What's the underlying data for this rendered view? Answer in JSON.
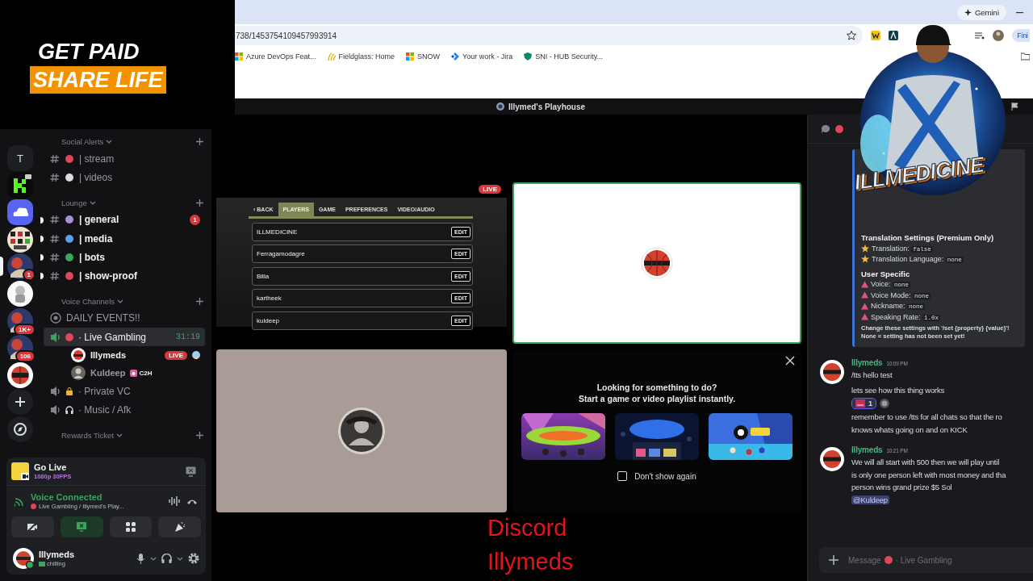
{
  "overlay": {
    "slogan": [
      "GET PAID",
      "SHARE LIFE"
    ],
    "mascot_title": "ILLMEDICINE",
    "caption": [
      "Discord",
      "Illymeds"
    ]
  },
  "browser": {
    "assistant_button": "Gemini",
    "url": "738/1453754109457993914",
    "profile_button": "Fini",
    "bookmarks": [
      {
        "label": "Azure DevOps Feat...",
        "kind": "squares"
      },
      {
        "label": "Fieldglass: Home",
        "kind": "leaf"
      },
      {
        "label": "SNOW",
        "kind": "squares"
      },
      {
        "label": "Your work - Jira",
        "kind": "jira"
      },
      {
        "label": "SNI - HUB Security...",
        "kind": "shield"
      }
    ]
  },
  "window": {
    "title": "Illymed's Playhouse"
  },
  "servers": [
    {
      "kind": "letter",
      "label": "T",
      "selected": false
    },
    {
      "kind": "kick",
      "selected": false
    },
    {
      "kind": "cloud",
      "selected": false
    },
    {
      "kind": "grid",
      "selected": false
    },
    {
      "kind": "art",
      "badge": "1",
      "selected": true
    },
    {
      "kind": "astronaut",
      "selected": false
    },
    {
      "kind": "art",
      "badge": "1K+",
      "selected": false
    },
    {
      "kind": "art",
      "badge": "106",
      "selected": false
    },
    {
      "kind": "ball",
      "selected": false
    },
    {
      "kind": "add"
    },
    {
      "kind": "discover"
    }
  ],
  "sidebar": {
    "channels": [
      {
        "kind": "category",
        "name": "Social Alerts"
      },
      {
        "kind": "text",
        "name": "| stream",
        "unread": false
      },
      {
        "kind": "text",
        "name": "| videos",
        "unread": false
      },
      {
        "kind": "category",
        "name": "Lounge"
      },
      {
        "kind": "text",
        "name": "| general",
        "unread": true,
        "badge": "1"
      },
      {
        "kind": "text",
        "name": "| media",
        "unread": true
      },
      {
        "kind": "text",
        "name": "| bots",
        "unread": true
      },
      {
        "kind": "text",
        "name": "| show-proof",
        "unread": true
      },
      {
        "kind": "category",
        "name": "Voice Channels"
      },
      {
        "kind": "stage",
        "name": "DAILY EVENTS!!"
      },
      {
        "kind": "voice",
        "name": "· Live Gambling",
        "selected": true,
        "timer": "31:19",
        "members": [
          {
            "name": "Illymeds",
            "badge": "LIVE"
          },
          {
            "name": "Kuldeep",
            "tag": "C2H"
          }
        ]
      },
      {
        "kind": "voice",
        "name": "· Private VC",
        "selected": false
      },
      {
        "kind": "voice",
        "name": "· Music / Afk",
        "selected": false
      },
      {
        "kind": "category",
        "name": "Rewards Ticket"
      }
    ]
  },
  "user_panel": {
    "go_live": {
      "title": "Go Live",
      "quality": "1080p 30FPS"
    },
    "voice": {
      "status": "Voice Connected",
      "channel": "Live Gambling / Illymed's Play..."
    },
    "user": {
      "name": "Illymeds",
      "status": "chilling"
    }
  },
  "stage": {
    "tiles": [
      {
        "kind": "screen",
        "badge": "LIVE",
        "speaking": false,
        "app": {
          "tabs": [
            {
              "label": "‹ BACK",
              "selected": false
            },
            {
              "label": "PLAYERS",
              "selected": true
            },
            {
              "label": "GAME",
              "selected": false
            },
            {
              "label": "PREFERENCES",
              "selected": false
            },
            {
              "label": "VIDEO/AUDIO",
              "selected": false
            }
          ],
          "players": [
            {
              "name": "ILLMEDICINE",
              "button": "EDIT"
            },
            {
              "name": "Ferragamodagre",
              "button": "EDIT"
            },
            {
              "name": "Billa",
              "button": "EDIT"
            },
            {
              "name": "kartheek",
              "button": "EDIT"
            },
            {
              "name": "kuldeep",
              "button": "EDIT"
            }
          ]
        }
      },
      {
        "kind": "avatar",
        "speaking": true
      },
      {
        "kind": "avatar",
        "speaking": false
      }
    ],
    "activity": {
      "heading": "Looking for something to do?",
      "subheading": "Start a game or video playlist instantly.",
      "dont_show_again": {
        "label": "Don't show again",
        "checked": false
      }
    }
  },
  "chat": {
    "embed": [
      {
        "kind": "heading",
        "text": "Translation Settings (Premium Only)"
      },
      {
        "kind": "premium",
        "label": "Translation:",
        "value": "false"
      },
      {
        "kind": "premium",
        "label": "Translation Language:",
        "value": "none"
      },
      {
        "kind": "heading",
        "text": "User Specific"
      },
      {
        "kind": "user",
        "label": "Voice:",
        "value": "none"
      },
      {
        "kind": "user",
        "label": "Voice Mode:",
        "value": "none"
      },
      {
        "kind": "user",
        "label": "Nickname:",
        "value": "none"
      },
      {
        "kind": "user",
        "label": "Speaking Rate:",
        "value": "1.0x"
      },
      {
        "kind": "note",
        "text": "Change these settings with '/set {property} {value}'!"
      },
      {
        "kind": "note",
        "text": "None = setting has not been set yet!"
      }
    ],
    "messages": [
      {
        "author": "Illymeds",
        "time": "10:09 PM",
        "paragraphs": [
          {
            "lines": [
              "/tts hello test"
            ]
          },
          {
            "lines": [
              "lets see how this thing works"
            ],
            "reaction": {
              "count": "1",
              "reacted": true
            }
          },
          {
            "lines": [
              "remember to use /tts for all chats so that the ro",
              "knows whats going on and on KICK"
            ]
          }
        ]
      },
      {
        "author": "Illymeds",
        "time": "10:21 PM",
        "paragraphs": [
          {
            "lines": [
              "We will all start with 500 then we will play until",
              "is only one person left with most money and tha",
              "person wins grand prize $5 Sol"
            ],
            "mention": "@Kuldeep"
          }
        ]
      }
    ],
    "composer": {
      "placeholder": "Message",
      "channel": "· Live Gambling"
    }
  }
}
